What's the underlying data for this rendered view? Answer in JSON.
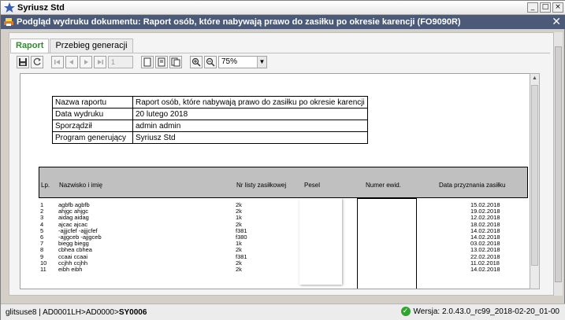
{
  "window": {
    "title": "Syriusz Std",
    "controls": [
      "_",
      "□",
      "×"
    ]
  },
  "dialog": {
    "title": "Podgląd wydruku dokumentu: Raport osób, które nabywają prawo do zasiłku po okresie karencji (FO9090R)",
    "close": "✕"
  },
  "tabs": [
    {
      "label": "Raport",
      "active": true
    },
    {
      "label": "Przebieg generacji",
      "active": false
    }
  ],
  "toolbar": {
    "page_value": "1",
    "zoom_value": "75%"
  },
  "report": {
    "info": [
      {
        "key": "Nazwa raportu",
        "value": "Raport osób, które nabywają prawo do zasiłku po okresie karencji"
      },
      {
        "key": "Data wydruku",
        "value": "20 lutego 2018"
      },
      {
        "key": "Sporządził",
        "value": "admin admin"
      },
      {
        "key": "Program generujący",
        "value": "Syriusz Std"
      }
    ],
    "columns": {
      "lp": "Lp.",
      "name": "Nazwisko i imię",
      "list": "Nr listy zasiłkowej",
      "pesel": "Pesel",
      "ewid": "Numer ewid.",
      "date": "Data przyznania zasiłku"
    },
    "rows": [
      {
        "lp": "1",
        "name": "agbfb agbfb",
        "list": "2k",
        "date": "15.02.2018"
      },
      {
        "lp": "2",
        "name": "ahjgc ahjgc",
        "list": "2k",
        "date": "19.02.2018"
      },
      {
        "lp": "3",
        "name": "aidag aidag",
        "list": "1k",
        "date": "12.02.2018"
      },
      {
        "lp": "4",
        "name": "ajcac ajcac",
        "list": "2k",
        "date": "18.02.2018"
      },
      {
        "lp": "5",
        "name": "-ajjjcfef -ajjjcfef",
        "list": "f381",
        "date": "14.02.2018"
      },
      {
        "lp": "6",
        "name": "-ajjgceb -ajjgceb",
        "list": "f380",
        "date": "14.02.2018"
      },
      {
        "lp": "7",
        "name": "biegg biegg",
        "list": "1k",
        "date": "03.02.2018"
      },
      {
        "lp": "8",
        "name": "cbhea cbhea",
        "list": "2k",
        "date": "13.02.2018"
      },
      {
        "lp": "9",
        "name": "ccaai ccaai",
        "list": "f381",
        "date": "22.02.2018"
      },
      {
        "lp": "10",
        "name": "ccjhh ccjhh",
        "list": "2k",
        "date": "11.02.2018"
      },
      {
        "lp": "11",
        "name": "eibh eibh",
        "list": "2k",
        "date": "14.02.2018"
      }
    ]
  },
  "statusbar": {
    "user": "glitsuse8",
    "path_prefix": "AD0001LH>AD0000>",
    "path_current": "SY0006",
    "version": "Wersja: 2.0.43.0_rc99_2018-02-20_01-00"
  },
  "colors": {
    "accent": "#2e8b2e",
    "dialog_bar": "#4a5a78"
  }
}
